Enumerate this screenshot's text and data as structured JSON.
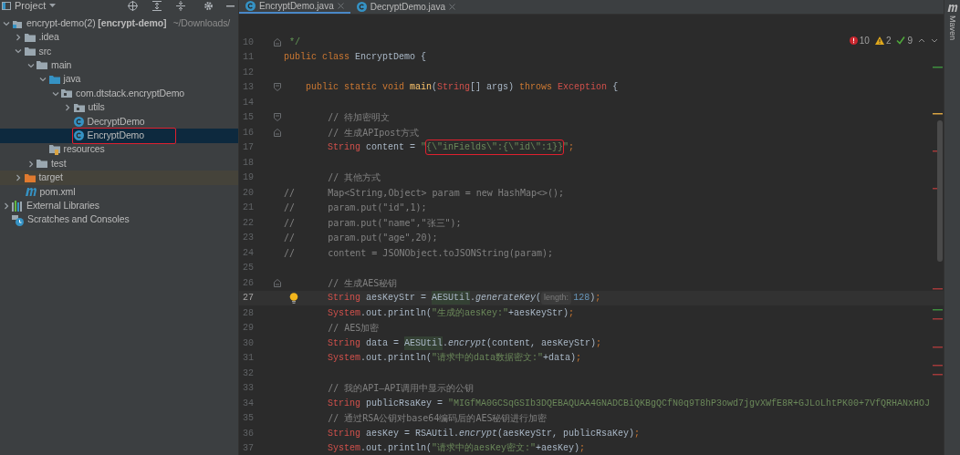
{
  "sidebar": {
    "title": "Project",
    "tree": [
      {
        "label": "encrypt-demo(2) **[encrypt-demo]**",
        "path": "~/Downloads/",
        "kind": "module",
        "selected": false,
        "annotated": false,
        "expanded": true,
        "children": [
          {
            "label": ".idea",
            "kind": "folder",
            "selected": false,
            "annotated": false,
            "expanded": false
          },
          {
            "label": "src",
            "kind": "folder",
            "selected": false,
            "annotated": false,
            "expanded": true,
            "children": [
              {
                "label": "main",
                "kind": "folder",
                "selected": false,
                "annotated": false,
                "expanded": true,
                "children": [
                  {
                    "label": "java",
                    "kind": "source-folder",
                    "selected": false,
                    "annotated": false,
                    "expanded": true,
                    "children": [
                      {
                        "label": "com.dtstack.encryptDemo",
                        "kind": "package",
                        "selected": false,
                        "annotated": false,
                        "expanded": true,
                        "children": [
                          {
                            "label": "utils",
                            "kind": "package",
                            "selected": false,
                            "annotated": false,
                            "expanded": false
                          },
                          {
                            "label": "DecryptDemo",
                            "kind": "class",
                            "selected": false,
                            "annotated": false
                          },
                          {
                            "label": "EncryptDemo",
                            "kind": "class",
                            "selected": true,
                            "annotated": true
                          }
                        ]
                      }
                    ]
                  },
                  {
                    "label": "resources",
                    "kind": "resources",
                    "selected": false,
                    "annotated": false
                  }
                ]
              },
              {
                "label": "test",
                "kind": "folder",
                "selected": false,
                "annotated": false,
                "expanded": false
              }
            ]
          },
          {
            "label": "target",
            "kind": "excluded-folder",
            "selected": false,
            "annotated": false,
            "expanded": false
          },
          {
            "label": "pom.xml",
            "kind": "maven",
            "selected": false,
            "annotated": false
          }
        ]
      },
      {
        "label": "External Libraries",
        "kind": "libraries",
        "selected": false,
        "annotated": false,
        "expanded": false
      },
      {
        "label": "Scratches and Consoles",
        "kind": "scratches",
        "selected": false,
        "annotated": false
      }
    ]
  },
  "tabs": [
    {
      "label": "EncryptDemo.java",
      "selected": true
    },
    {
      "label": "DecryptDemo.java",
      "selected": false
    }
  ],
  "inspection": {
    "errors": "10",
    "warnings": "2",
    "weak_warnings": "9"
  },
  "right_stripe": {
    "label": "Maven"
  },
  "lines": [
    {
      "number": "10",
      "kind": "fold-end",
      "current": false,
      "tokens": [
        {
          "kind": "doc",
          "text": " */"
        }
      ]
    },
    {
      "number": "11",
      "kind": "plain",
      "current": false,
      "tokens": [
        {
          "kind": "keyword",
          "text": "public class "
        },
        {
          "kind": "plain",
          "text": "EncryptDemo {"
        }
      ]
    },
    {
      "number": "12",
      "kind": "plain",
      "current": false
    },
    {
      "number": "13",
      "kind": "fold-start",
      "current": false,
      "tokens": [
        {
          "kind": "keyword",
          "text": "    public static void "
        },
        {
          "kind": "method",
          "text": "main"
        },
        {
          "kind": "plain",
          "text": "("
        },
        {
          "kind": "type",
          "text": "String"
        },
        {
          "kind": "plain",
          "text": "[] args) "
        },
        {
          "kind": "keyword",
          "text": "throws "
        },
        {
          "kind": "type",
          "text": "Exception"
        },
        {
          "kind": "plain",
          "text": " {"
        }
      ]
    },
    {
      "number": "14",
      "kind": "plain",
      "current": false
    },
    {
      "number": "15",
      "kind": "fold-start",
      "current": false,
      "tokens": [
        {
          "kind": "comment",
          "text": "        // 待加密明文"
        }
      ]
    },
    {
      "number": "16",
      "kind": "fold-end",
      "current": false,
      "tokens": [
        {
          "kind": "comment",
          "text": "        // 生成APIpost方式"
        }
      ]
    },
    {
      "number": "17",
      "kind": "plain",
      "current": false,
      "tokens": [
        {
          "kind": "type",
          "text": "        String"
        },
        {
          "kind": "plain",
          "text": " content = "
        },
        {
          "kind": "string",
          "text": "\""
        },
        {
          "kind": "string",
          "text": "{\\\"inFields\\\":{\\\"id\\\":1}}",
          "boxed": true
        },
        {
          "kind": "string",
          "text": "\""
        },
        {
          "kind": "punct",
          "text": ";"
        }
      ]
    },
    {
      "number": "18",
      "kind": "plain",
      "current": false
    },
    {
      "number": "19",
      "kind": "plain",
      "current": false,
      "tokens": [
        {
          "kind": "comment",
          "text": "        // 其他方式"
        }
      ]
    },
    {
      "number": "20",
      "kind": "plain",
      "current": false,
      "tokens": [
        {
          "kind": "comment",
          "text": "//      Map<String,Object> param = new HashMap<>();"
        }
      ]
    },
    {
      "number": "21",
      "kind": "plain",
      "current": false,
      "tokens": [
        {
          "kind": "comment",
          "text": "//      param.put(\"id\",1);"
        }
      ]
    },
    {
      "number": "22",
      "kind": "plain",
      "current": false,
      "tokens": [
        {
          "kind": "comment",
          "text": "//      param.put(\"name\",\"张三\");"
        }
      ]
    },
    {
      "number": "23",
      "kind": "plain",
      "current": false,
      "tokens": [
        {
          "kind": "comment",
          "text": "//      param.put(\"age\",20);"
        }
      ]
    },
    {
      "number": "24",
      "kind": "plain",
      "current": false,
      "tokens": [
        {
          "kind": "comment",
          "text": "//      content = JSONObject.toJSONString(param);"
        }
      ]
    },
    {
      "number": "25",
      "kind": "plain",
      "current": false
    },
    {
      "number": "26",
      "kind": "fold-end",
      "current": false,
      "tokens": [
        {
          "kind": "comment",
          "text": "        // 生成AES秘钥"
        }
      ]
    },
    {
      "number": "27",
      "kind": "plain",
      "current": true,
      "bulb": true,
      "tokens": [
        {
          "kind": "type",
          "text": "        String"
        },
        {
          "kind": "plain",
          "text": " aesKeyStr = "
        },
        {
          "kind": "usage",
          "text": "AESUtil"
        },
        {
          "kind": "plain",
          "text": "."
        },
        {
          "kind": "static",
          "text": "generateKey"
        },
        {
          "kind": "plain",
          "text": "("
        },
        {
          "kind": "hint",
          "text": "length:"
        },
        {
          "kind": "number",
          "text": "128"
        },
        {
          "kind": "plain",
          "text": ")"
        },
        {
          "kind": "punct",
          "text": ";"
        }
      ]
    },
    {
      "number": "28",
      "kind": "plain",
      "current": false,
      "tokens": [
        {
          "kind": "type",
          "text": "        System"
        },
        {
          "kind": "plain",
          "text": ".out.println("
        },
        {
          "kind": "string",
          "text": "\"生成的aesKey:\""
        },
        {
          "kind": "plain",
          "text": "+aesKeyStr)"
        },
        {
          "kind": "punct",
          "text": ";"
        }
      ]
    },
    {
      "number": "29",
      "kind": "plain",
      "current": false,
      "tokens": [
        {
          "kind": "comment",
          "text": "        // AES加密"
        }
      ]
    },
    {
      "number": "30",
      "kind": "plain",
      "current": false,
      "tokens": [
        {
          "kind": "type",
          "text": "        String"
        },
        {
          "kind": "plain",
          "text": " data = "
        },
        {
          "kind": "usage",
          "text": "AESUtil"
        },
        {
          "kind": "plain",
          "text": "."
        },
        {
          "kind": "static",
          "text": "encrypt"
        },
        {
          "kind": "plain",
          "text": "(content, aesKeyStr)"
        },
        {
          "kind": "punct",
          "text": ";"
        }
      ]
    },
    {
      "number": "31",
      "kind": "plain",
      "current": false,
      "tokens": [
        {
          "kind": "type",
          "text": "        System"
        },
        {
          "kind": "plain",
          "text": ".out.println("
        },
        {
          "kind": "string",
          "text": "\"请求中的data数据密文:\""
        },
        {
          "kind": "plain",
          "text": "+data)"
        },
        {
          "kind": "punct",
          "text": ";"
        }
      ]
    },
    {
      "number": "32",
      "kind": "plain",
      "current": false
    },
    {
      "number": "33",
      "kind": "plain",
      "current": false,
      "tokens": [
        {
          "kind": "comment",
          "text": "        // 我的API—API调用中显示的公钥"
        }
      ]
    },
    {
      "number": "34",
      "kind": "plain",
      "current": false,
      "tokens": [
        {
          "kind": "type",
          "text": "        String"
        },
        {
          "kind": "plain",
          "text": " publicRsaKey = "
        },
        {
          "kind": "string",
          "text": "\"MIGfMA0GCSqGSIb3DQEBAQUAA4GNADCBiQKBgQCfN0q9T8hP3owd7jgvXWfE8R+GJLoLhtPK00+7VfQRHANxHOJ"
        }
      ]
    },
    {
      "number": "35",
      "kind": "plain",
      "current": false,
      "tokens": [
        {
          "kind": "comment",
          "text": "        // 通过RSA公钥对base64编码后的AES秘钥进行加密"
        }
      ]
    },
    {
      "number": "36",
      "kind": "plain",
      "current": false,
      "tokens": [
        {
          "kind": "type",
          "text": "        String"
        },
        {
          "kind": "plain",
          "text": " aesKey = RSAUtil."
        },
        {
          "kind": "static",
          "text": "encrypt"
        },
        {
          "kind": "plain",
          "text": "(aesKeyStr, publicRsaKey)"
        },
        {
          "kind": "punct",
          "text": ";"
        }
      ]
    },
    {
      "number": "37",
      "kind": "plain",
      "current": false,
      "tokens": [
        {
          "kind": "type",
          "text": "        System"
        },
        {
          "kind": "plain",
          "text": ".out.println("
        },
        {
          "kind": "string",
          "text": "\"请求中的aesKey密文:\""
        },
        {
          "kind": "plain",
          "text": "+aesKey)"
        },
        {
          "kind": "punct",
          "text": ";"
        }
      ]
    }
  ]
}
